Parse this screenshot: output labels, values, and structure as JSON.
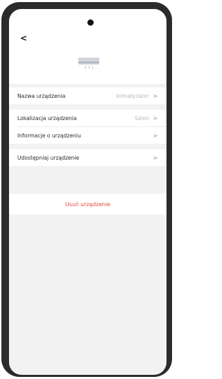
{
  "header": {
    "back_icon": "chevron-left-icon",
    "device_icon": "air-conditioner-icon",
    "back_label": "<"
  },
  "settings": {
    "rows": [
      {
        "label": "Nazwa urządzenia",
        "value": "klimatyzator",
        "chevron": ">"
      },
      {
        "label": "Lokalizacja urządzenia",
        "value": "Salon",
        "chevron": ">"
      },
      {
        "label": "Informacje o urządzeniu",
        "value": "",
        "chevron": ">"
      },
      {
        "label": "Udostępniaj urządzenie",
        "value": "",
        "chevron": ">"
      }
    ]
  },
  "actions": {
    "delete_label": "Usuń urządzenie"
  },
  "colors": {
    "accent_red": "#e24a3b",
    "background": "#f2f2f2"
  }
}
